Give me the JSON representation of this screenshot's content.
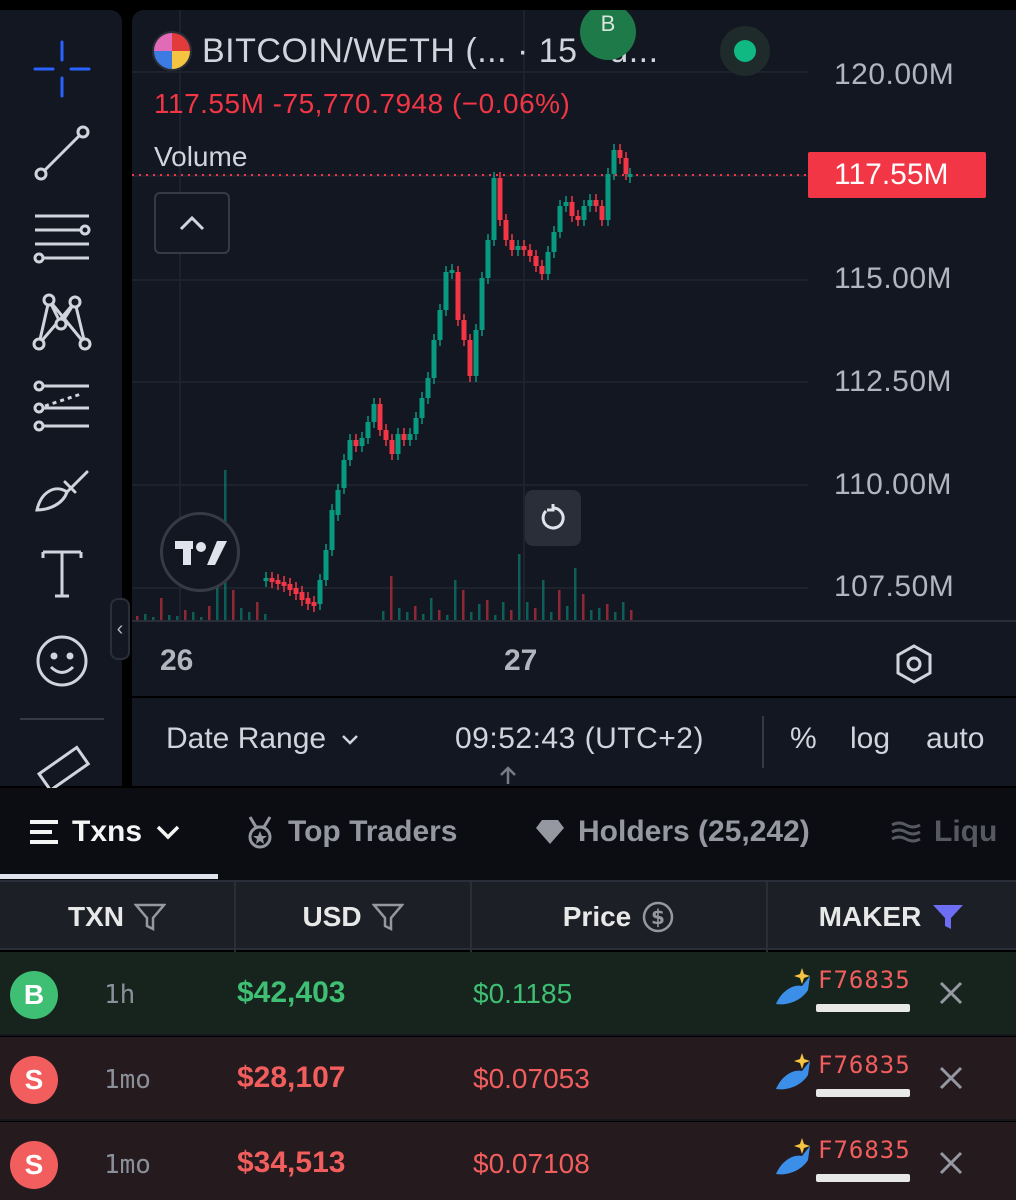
{
  "chart": {
    "symbol": "BITCOIN/WETH (... · 15 · d...",
    "top_marker": "B",
    "ohlc_summary": "117.55M  -75,770.7948 (−0.06%)",
    "volume_label": "Volume",
    "current_price": "117.55M",
    "price_labels": [
      "120.00M",
      "115.00M",
      "112.50M",
      "110.00M",
      "107.50M"
    ],
    "time_labels": [
      "26",
      "27"
    ],
    "accent_up": "#089981",
    "accent_down": "#f23645"
  },
  "bottom_bar": {
    "date_range": "Date Range",
    "clock": "09:52:43 (UTC+2)",
    "percent": "%",
    "log": "log",
    "auto": "auto"
  },
  "tabs": [
    {
      "label": "Txns",
      "icon": "list-icon"
    },
    {
      "label": "Top Traders",
      "icon": "medal-icon"
    },
    {
      "label": "Holders (25,242)",
      "icon": "diamond-icon"
    },
    {
      "label": "Liqu",
      "icon": "waves-icon"
    }
  ],
  "table": {
    "headers": {
      "txn": "TXN",
      "usd": "USD",
      "price": "Price",
      "maker": "MAKER"
    },
    "rows": [
      {
        "type": "B",
        "side": "buy",
        "age": "1h",
        "usd": "$42,403",
        "price": "$0.1185",
        "maker": "F76835"
      },
      {
        "type": "S",
        "side": "sell",
        "age": "1mo",
        "usd": "$28,107",
        "price": "$0.07053",
        "maker": "F76835"
      },
      {
        "type": "S",
        "side": "sell",
        "age": "1mo",
        "usd": "$34,513",
        "price": "$0.07108",
        "maker": "F76835"
      }
    ]
  }
}
